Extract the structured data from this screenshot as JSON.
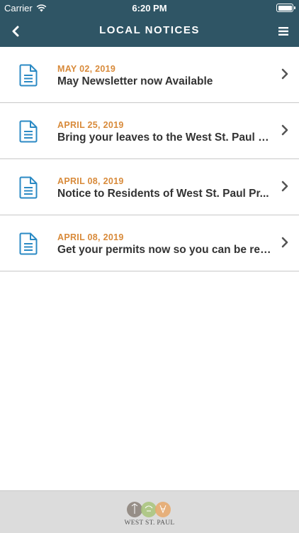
{
  "status_bar": {
    "carrier": "Carrier",
    "time": "6:20 PM",
    "icons": [
      "wifi-icon",
      "battery-icon"
    ]
  },
  "navbar": {
    "title": "LOCAL NOTICES",
    "back_icon": "chevron-left-icon",
    "menu_icon": "hamburger-menu-icon"
  },
  "notices": [
    {
      "date": "MAY 02, 2019",
      "title": "May Newsletter now Available"
    },
    {
      "date": "APRIL 25, 2019",
      "title": "Bring your leaves to the West St. Paul S..."
    },
    {
      "date": "APRIL 08, 2019",
      "title": "Notice to Residents of West St. Paul Pr..."
    },
    {
      "date": "APRIL 08, 2019",
      "title": "Get your permits now so you can be rea..."
    }
  ],
  "footer": {
    "logo_text": "WEST ST. PAUL"
  },
  "colors": {
    "header_bg": "#2f5565",
    "date_accent": "#d88a3a",
    "icon_blue": "#2b8ac4",
    "footer_bg": "#dcdcdc"
  }
}
